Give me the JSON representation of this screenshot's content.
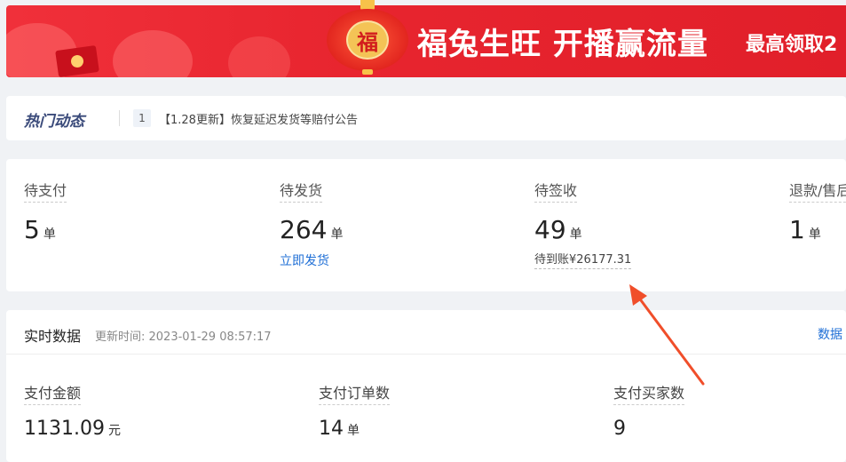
{
  "banner": {
    "lantern_char": "福",
    "slogan": "福兔生旺 开播赢流量",
    "promo": "最高领取2"
  },
  "news": {
    "title": "热门动态",
    "index": "1",
    "text": "【1.28更新】恢复延迟发货等赔付公告"
  },
  "orders": [
    {
      "label": "待支付",
      "value": "5",
      "unit": "单"
    },
    {
      "label": "待发货",
      "value": "264",
      "unit": "单",
      "link": "立即发货"
    },
    {
      "label": "待签收",
      "value": "49",
      "unit": "单",
      "sub": "待到账¥26177.31"
    },
    {
      "label": "退款/售后",
      "value": "1",
      "unit": "单"
    }
  ],
  "realtime": {
    "title": "实时数据",
    "update_time": "更新时间: 2023-01-29 08:57:17",
    "more": "数据",
    "metrics": [
      {
        "label": "支付金额",
        "value": "1131.09",
        "unit": "元"
      },
      {
        "label": "支付订单数",
        "value": "14",
        "unit": "单"
      },
      {
        "label": "支付买家数",
        "value": "9",
        "unit": ""
      }
    ]
  },
  "colors": {
    "banner": "#e8252f",
    "link": "#1f6fd6",
    "arrow": "#f04e2a"
  }
}
